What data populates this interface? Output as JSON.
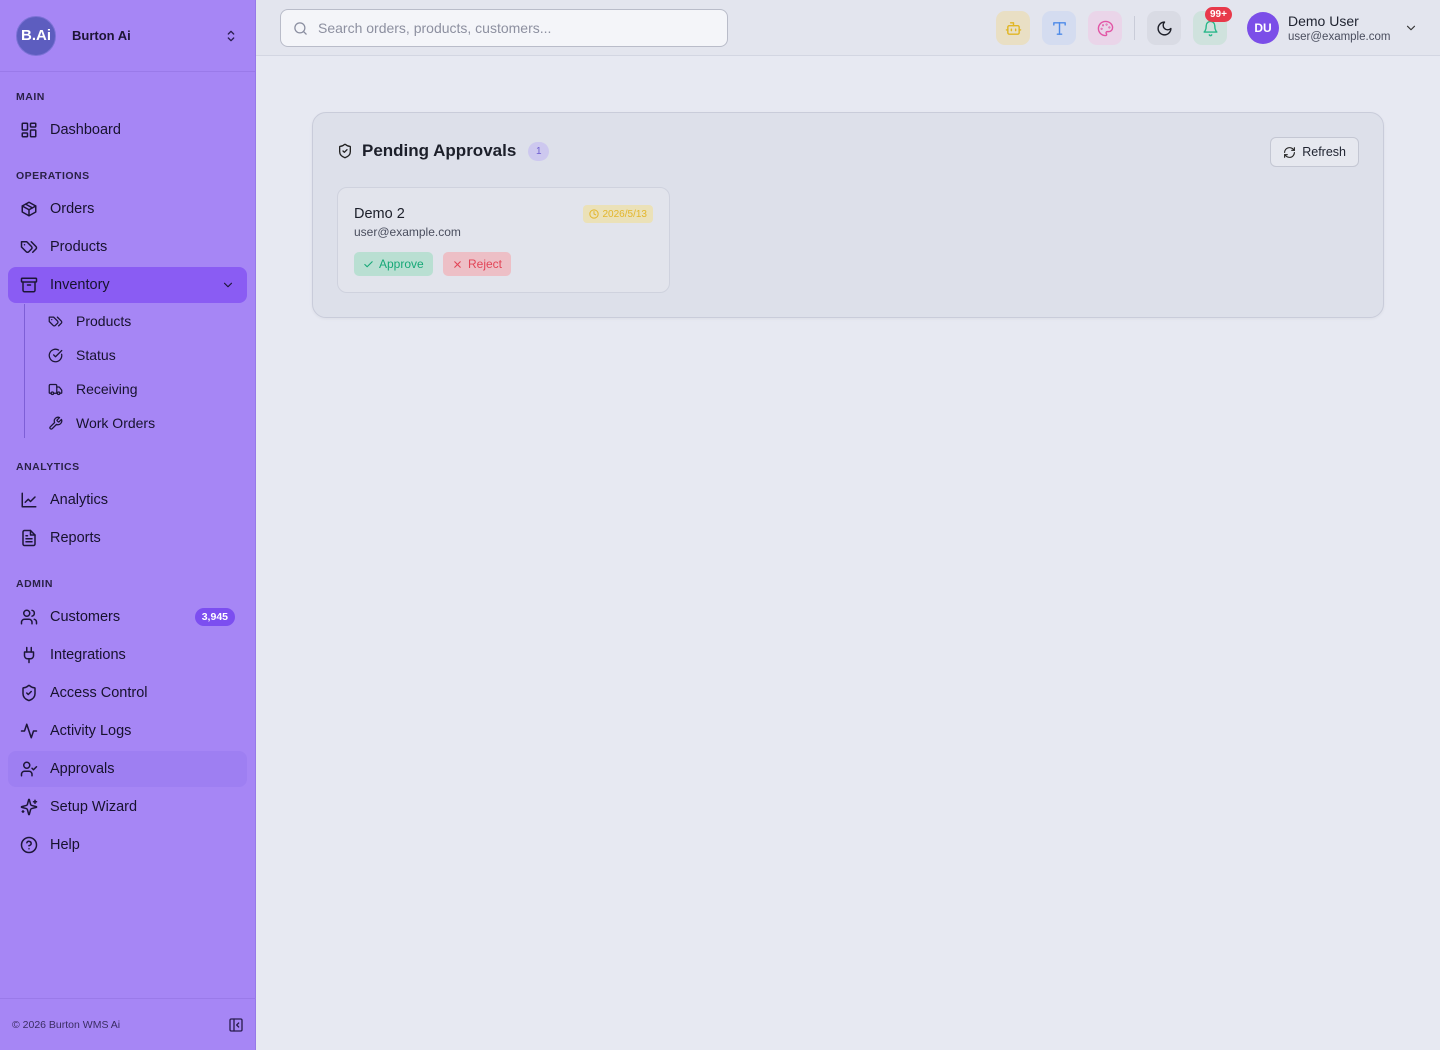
{
  "brand": {
    "logo": "B.Ai",
    "name": "Burton Ai"
  },
  "sections": {
    "main": "MAIN",
    "operations": "OPERATIONS",
    "analytics": "ANALYTICS",
    "admin": "ADMIN"
  },
  "nav": {
    "dashboard": "Dashboard",
    "orders": "Orders",
    "products": "Products",
    "inventory": "Inventory",
    "analytics": "Analytics",
    "reports": "Reports",
    "customers": "Customers",
    "customers_badge": "3,945",
    "integrations": "Integrations",
    "access_control": "Access Control",
    "activity_logs": "Activity Logs",
    "approvals": "Approvals",
    "setup_wizard": "Setup Wizard",
    "help": "Help"
  },
  "inventory_sub": {
    "products": "Products",
    "status": "Status",
    "receiving": "Receiving",
    "work_orders": "Work Orders"
  },
  "footer": {
    "copyright": "© 2026 Burton WMS Ai"
  },
  "header": {
    "search_placeholder": "Search orders, products, customers...",
    "notification_badge": "99+",
    "user": {
      "initials": "DU",
      "name": "Demo User",
      "email": "user@example.com"
    }
  },
  "approvals": {
    "title": "Pending Approvals",
    "count": "1",
    "refresh_label": "Refresh",
    "items": [
      {
        "name": "Demo 2",
        "email": "user@example.com",
        "date": "2026/5/13",
        "approve_label": "Approve",
        "reject_label": "Reject"
      }
    ]
  },
  "colors": {
    "sidebar": "#a686f5",
    "active": "#8a5cf3",
    "approve": "#17a877",
    "reject": "#e24557",
    "pending": "#e3b62b"
  }
}
